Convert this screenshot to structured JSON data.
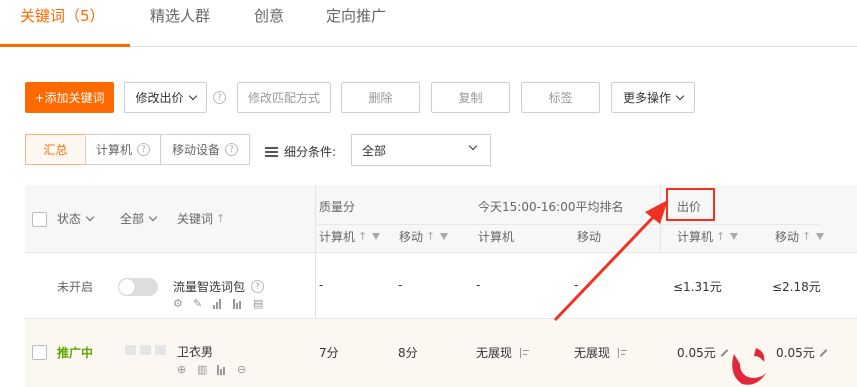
{
  "tabs": [
    "关键词（5）",
    "精选人群",
    "创意",
    "定向推广"
  ],
  "toolbar": {
    "add": "+添加关键词",
    "modify_bid": "修改出价",
    "modify_match": "修改匹配方式",
    "delete": "删除",
    "copy": "复制",
    "tag": "标签",
    "more": "更多操作"
  },
  "segments": [
    "汇总",
    "计算机",
    "移动设备"
  ],
  "filter": {
    "label": "细分条件:",
    "value": "全部"
  },
  "header": {
    "status": "状态",
    "all": "全部",
    "keyword": "关键词",
    "quality": "质量分",
    "rank_group": "今天15:00-16:00平均排名",
    "bid": "出价",
    "computer": "计算机",
    "mobile": "移动"
  },
  "rows": [
    {
      "status": "未开启",
      "keyword": "流量智选词包",
      "q_pc": "-",
      "q_mobile": "-",
      "rank_pc": "-",
      "rank_mobile": "-",
      "bid_pc": "≤1.31元",
      "bid_mobile": "≤2.18元"
    },
    {
      "status": "推广中",
      "keyword": "卫衣男",
      "q_pc": "7分",
      "q_mobile": "8分",
      "rank_pc": "无展现",
      "rank_mobile": "无展现",
      "bid_pc": "0.05元",
      "bid_mobile": "0.05元"
    }
  ],
  "colors": {
    "accent": "#ff6a00",
    "annotation": "#ee3322",
    "active_status": "#5aa700"
  },
  "icons": [
    "help-icon",
    "chevron-down-icon",
    "filter-list-icon",
    "funnel-icon",
    "sort-arrow-icon",
    "settings-icon",
    "wrench-icon",
    "chart-icon",
    "report-icon",
    "target-icon",
    "trash-icon",
    "more-icon",
    "pencil-icon",
    "rank-icon"
  ]
}
